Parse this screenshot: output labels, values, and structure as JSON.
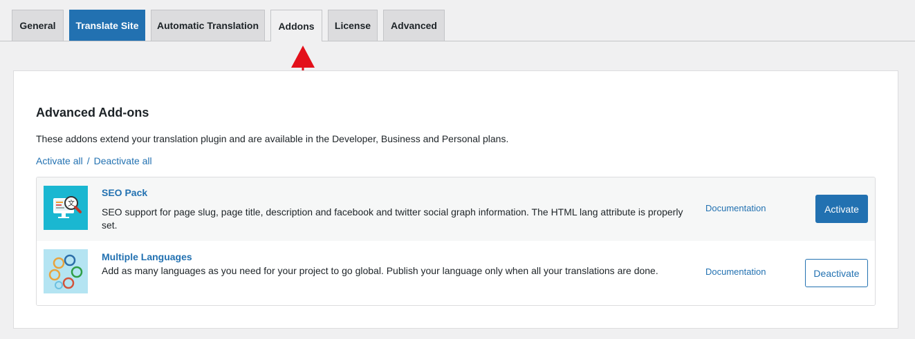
{
  "tabs": [
    {
      "label": "General"
    },
    {
      "label": "Translate Site"
    },
    {
      "label": "Automatic Translation"
    },
    {
      "label": "Addons"
    },
    {
      "label": "License"
    },
    {
      "label": "Advanced"
    }
  ],
  "active_tab": "Addons",
  "highlighted_tab": "Translate Site",
  "section": {
    "title": "Advanced Add-ons",
    "description": "These addons extend your translation plugin and are available in the Developer, Business and Personal plans.",
    "activate_all": "Activate all",
    "separator": "/",
    "deactivate_all": "Deactivate all"
  },
  "addons": [
    {
      "name": "SEO Pack",
      "description": "SEO support for page slug, page title, description and facebook and twitter social graph information. The HTML lang attribute is properly set.",
      "doc_label": "Documentation",
      "button_label": "Activate",
      "icon": "seo-monitor-translate-icon",
      "thumb_color": "#1ab7d1"
    },
    {
      "name": "Multiple Languages",
      "description": "Add as many languages as you need for your project to go global. Publish your language only when all your translations are done.",
      "doc_label": "Documentation",
      "button_label": "Deactivate",
      "icon": "speech-bubbles-icon",
      "thumb_color": "#b4e4f2"
    }
  ],
  "colors": {
    "accent": "#2271b1",
    "annotation_arrow": "#e3101a"
  }
}
